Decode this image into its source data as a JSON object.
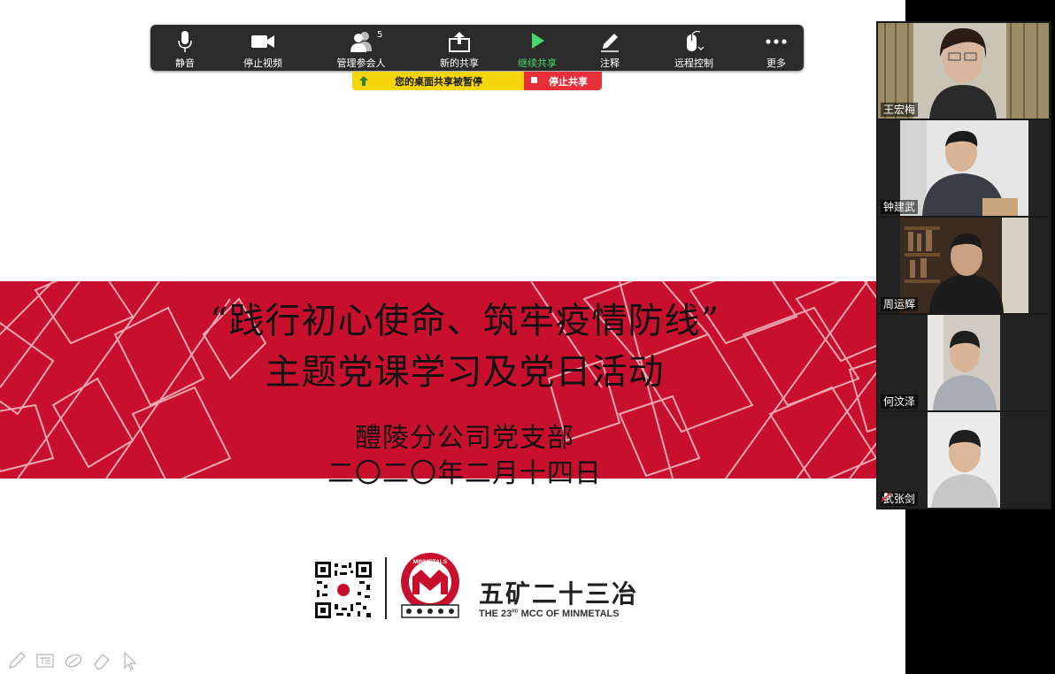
{
  "toolbar": {
    "mute": "静音",
    "stop_video": "停止视频",
    "participants": "管理参会人",
    "participants_count": "5",
    "new_share": "新的共享",
    "resume_share": "继续共享",
    "annotate": "注释",
    "remote_control": "远程控制",
    "more": "更多"
  },
  "share_banner": {
    "paused_text": "您的桌面共享被暂停",
    "stop_text": "停止共享",
    "paused_color": "#f5d60a",
    "stop_color": "#e8303a"
  },
  "slide": {
    "title_line1": "“践行初心使命、筑牢疫情防线”",
    "title_line2": "主题党课学习及党日活动",
    "organization": "醴陵分公司党支部",
    "date": "二〇二〇年二月十四日",
    "brand_cn": "五矿二十三冶",
    "brand_en_prefix": "THE 23",
    "brand_en_sup": "RD",
    "brand_en_suffix": " MCC OF MINMETALS",
    "emblem_text": "MINMETALS",
    "band_color": "#c8102e"
  },
  "participants": [
    {
      "name": "王宏梅",
      "muted": false
    },
    {
      "name": "钟建武",
      "muted": false
    },
    {
      "name": "周运辉",
      "muted": false,
      "active_speaker": true
    },
    {
      "name": "何汶泽",
      "muted": false
    },
    {
      "name": "武张剑",
      "muted": true
    }
  ],
  "annotation_tools": [
    "pen-icon",
    "text-icon",
    "shape-icon",
    "eraser-icon",
    "pointer-icon"
  ]
}
